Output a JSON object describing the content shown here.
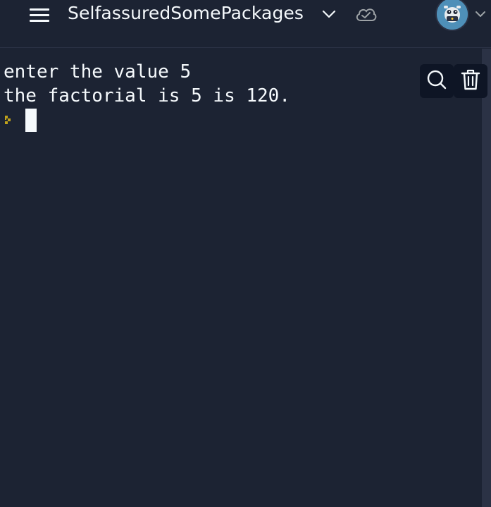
{
  "header": {
    "repl_name": "SelfassuredSomePackages",
    "icons": {
      "menu": "hamburger-menu-icon",
      "repl_dropdown": "chevron-down-icon",
      "saved_status": "cloud-check-icon",
      "avatar": "user-avatar",
      "avatar_dropdown": "chevron-down-icon"
    }
  },
  "console": {
    "lines": [
      "enter the value 5",
      "the factorial is 5 is 120."
    ],
    "prompt_icon": "prompt-chevron-icon",
    "prompt_color": "#c0a21c",
    "tools": {
      "search": "search-icon",
      "clear": "trash-icon"
    }
  },
  "colors": {
    "background": "#1c2333",
    "text": "#f5f9fc",
    "scrollbar": "#2b3245",
    "tool_button_bg": "#0e1525"
  }
}
